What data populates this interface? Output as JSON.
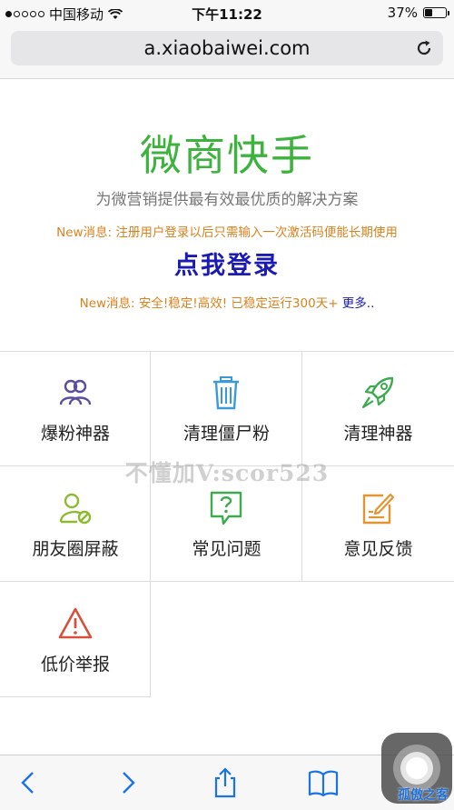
{
  "status_bar": {
    "carrier": "中国移动",
    "time": "下午11:22",
    "battery": "37%",
    "battery_level": 0.37,
    "signal_bars": 1
  },
  "browser": {
    "url": "a.xiaobaiwei.com"
  },
  "hero": {
    "title": "微商快手",
    "subtitle": "为微营销提供最有效最优质的解决方案",
    "notice1": "New消息: 注册用户登录以后只需输入一次激活码便能长期使用",
    "login": "点我登录",
    "notice2": "New消息: 安全!稳定!高效! 已稳定运行300天+",
    "more": "更多.."
  },
  "menu": [
    {
      "label": "爆粉神器",
      "icon": "users-icon",
      "color": "#5b4e9e"
    },
    {
      "label": "清理僵尸粉",
      "icon": "trash-icon",
      "color": "#3a9ad9"
    },
    {
      "label": "清理神器",
      "icon": "rocket-icon",
      "color": "#3caa4e"
    },
    {
      "label": "朋友圈屏蔽",
      "icon": "user-block-icon",
      "color": "#8cbc2e"
    },
    {
      "label": "常见问题",
      "icon": "question-bubble-icon",
      "color": "#3caa4e"
    },
    {
      "label": "意见反馈",
      "icon": "edit-icon",
      "color": "#e49431"
    },
    {
      "label": "低价举报",
      "icon": "warning-icon",
      "color": "#d5523a"
    }
  ],
  "watermark": "不懂加V:scor523",
  "corner_watermark": "孤傲之客"
}
